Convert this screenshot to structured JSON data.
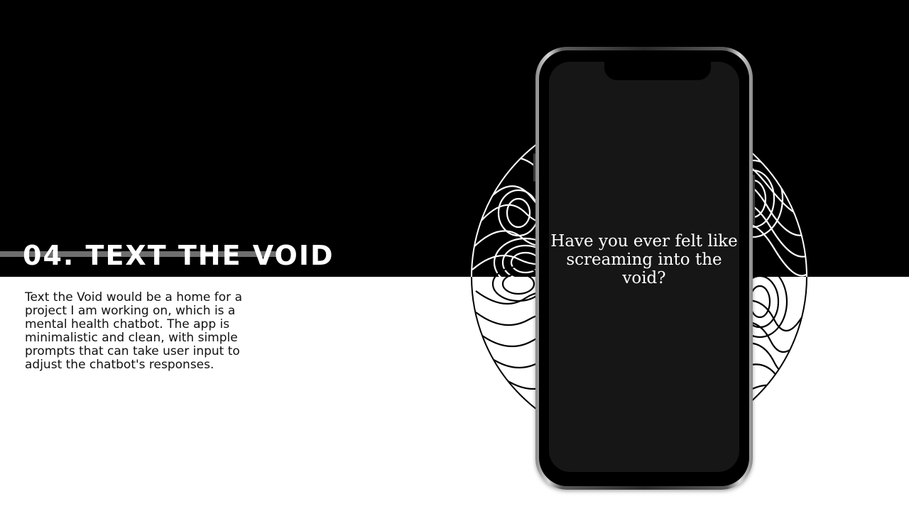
{
  "slide": {
    "title": "04. TEXT THE VOID",
    "description": "Text the Void would be a home for a project I am working on, which is a mental health chatbot. The app is minimalistic and clean, with simple prompts that can take user input to adjust the chatbot's responses."
  },
  "phone": {
    "screen_text": "Have you ever felt like screaming into the void?"
  },
  "colors": {
    "background_top": "#000000",
    "background_bottom": "#ffffff",
    "accent_bar": "#6e6e6e",
    "screen": "#161616"
  },
  "icons": [
    "topographic-contour-circle",
    "smartphone-mockup"
  ]
}
